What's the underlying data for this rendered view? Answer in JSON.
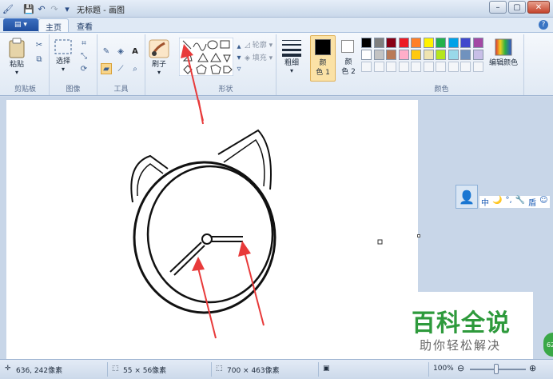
{
  "window": {
    "title": "无标题 - 画图"
  },
  "tabs": [
    {
      "label": "主页"
    },
    {
      "label": "查看"
    }
  ],
  "ribbon": {
    "clipboard": {
      "paste_label": "粘贴",
      "group_label": "剪贴板"
    },
    "image": {
      "select_label": "选择",
      "group_label": "图像"
    },
    "tools": {
      "group_label": "工具",
      "text_tool": "A"
    },
    "brush": {
      "label": "刷子"
    },
    "shapes": {
      "outline_label": "轮廓",
      "fill_label": "填充",
      "group_label": "形状"
    },
    "size": {
      "label": "粗细"
    },
    "color1": {
      "label_line1": "颜",
      "label_line2": "色 1"
    },
    "color2": {
      "label_line1": "颜",
      "label_line2": "色 2"
    },
    "colors": {
      "group_label": "颜色",
      "edit_label": "编辑颜色",
      "palette_row1": [
        "#000000",
        "#7f7f7f",
        "#880015",
        "#ed1c24",
        "#ff7f27",
        "#fff200",
        "#22b14c",
        "#00a2e8",
        "#3f48cc",
        "#a349a4"
      ],
      "palette_row2": [
        "#ffffff",
        "#c3c3c3",
        "#b97a57",
        "#ffaec9",
        "#ffc90e",
        "#efe4b0",
        "#b5e61d",
        "#99d9ea",
        "#7092be",
        "#c8bfe7"
      ]
    }
  },
  "qq_bar": {
    "t1": "中",
    "t2": "🌙",
    "t3": "°,",
    "t4": "🔧",
    "t5": "盾",
    "t6": "☺"
  },
  "green_badge": {
    "text": "62"
  },
  "watermark": {
    "title": "百科全说",
    "subtitle": "助你轻松解决"
  },
  "status": {
    "cursor_pos": "636, 242像素",
    "selection_size": "55 × 56像素",
    "image_size": "700 × 463像素",
    "zoom": "100%"
  },
  "colors": {
    "accent": "#1f4e9e",
    "arrow": "#e83a3a",
    "watermark_green": "#2e9a3c"
  }
}
